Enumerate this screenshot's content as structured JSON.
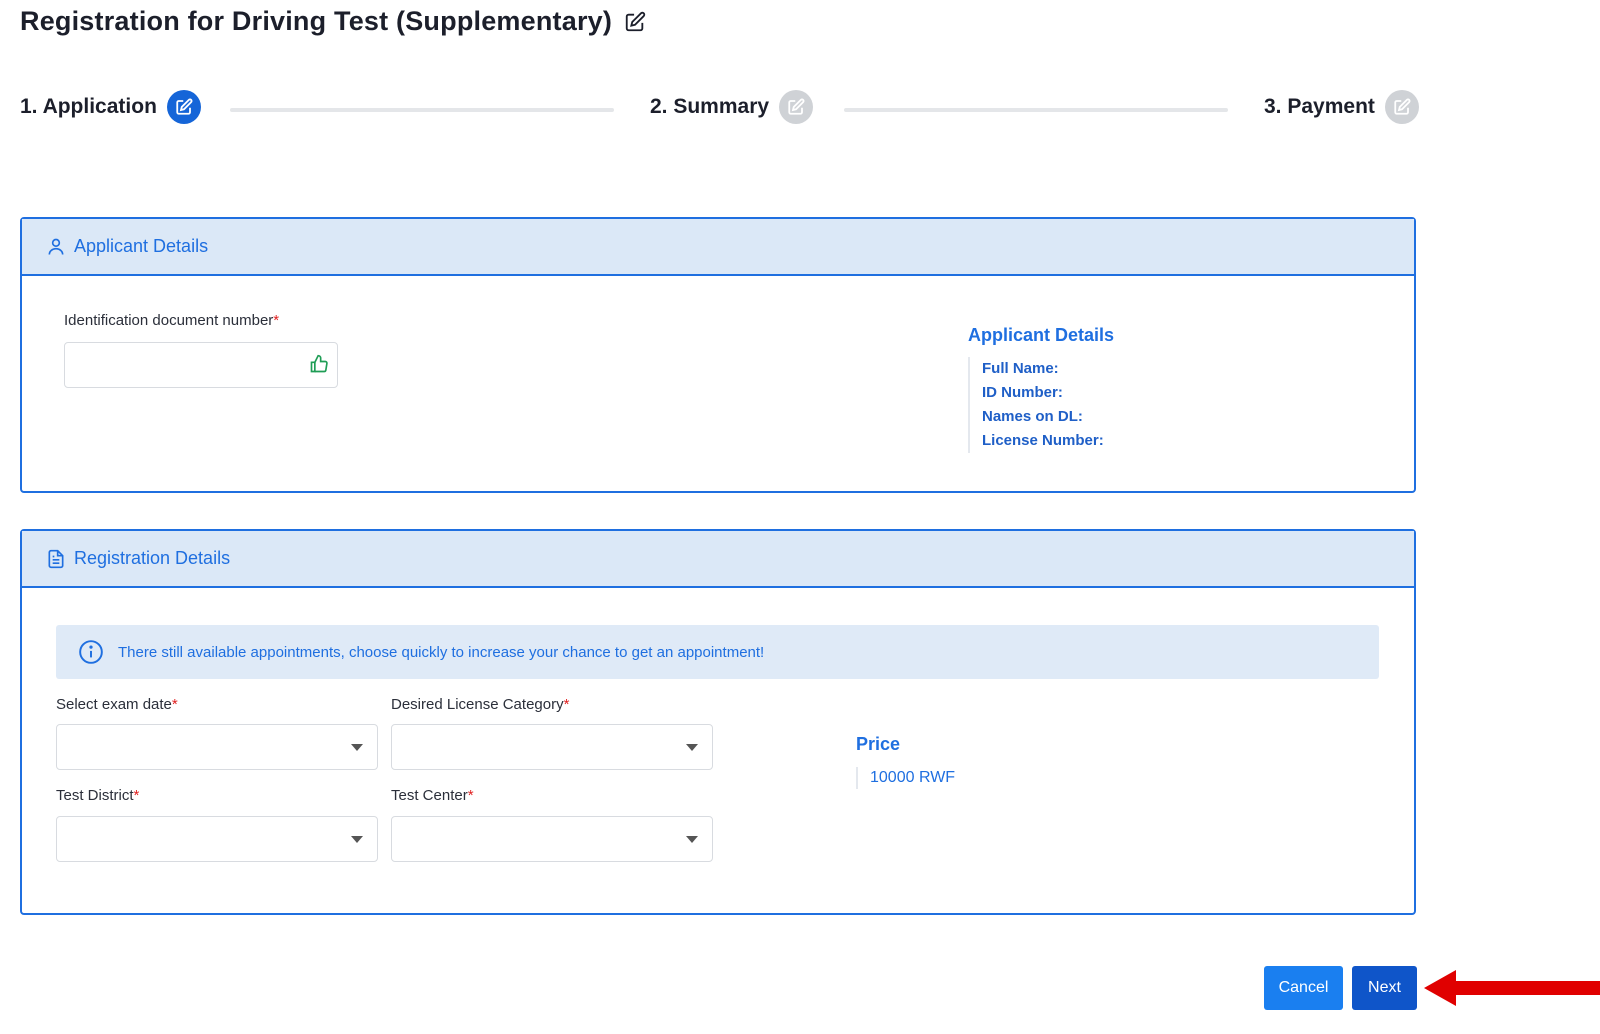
{
  "page": {
    "title": "Registration for Driving Test (Supplementary)"
  },
  "stepper": {
    "steps": [
      {
        "label": "1. Application",
        "state": "active"
      },
      {
        "label": "2. Summary",
        "state": "inactive"
      },
      {
        "label": "3. Payment",
        "state": "inactive"
      }
    ]
  },
  "applicant_panel": {
    "header": "Applicant Details",
    "id_field": {
      "label": "Identification document number",
      "value": "",
      "placeholder": ""
    },
    "details": {
      "title": "Applicant Details",
      "full_name_label": "Full Name:",
      "id_number_label": "ID Number:",
      "names_on_dl_label": "Names on DL:",
      "license_number_label": "License Number:"
    }
  },
  "registration_panel": {
    "header": "Registration Details",
    "info_message": "There still available appointments, choose quickly to increase your chance to get an appointment!",
    "exam_date": {
      "label": "Select exam date",
      "value": ""
    },
    "license_category": {
      "label": "Desired License Category",
      "value": ""
    },
    "test_district": {
      "label": "Test District",
      "value": ""
    },
    "test_center": {
      "label": "Test Center",
      "value": ""
    },
    "price": {
      "title": "Price",
      "value": "10000 RWF"
    }
  },
  "actions": {
    "cancel_label": "Cancel",
    "next_label": "Next"
  },
  "colors": {
    "primary": "#1f6fe0",
    "panel_header_bg": "#dbe8f7",
    "required": "#e02020",
    "annotation_arrow": "#e00000"
  },
  "required_marker": "*"
}
